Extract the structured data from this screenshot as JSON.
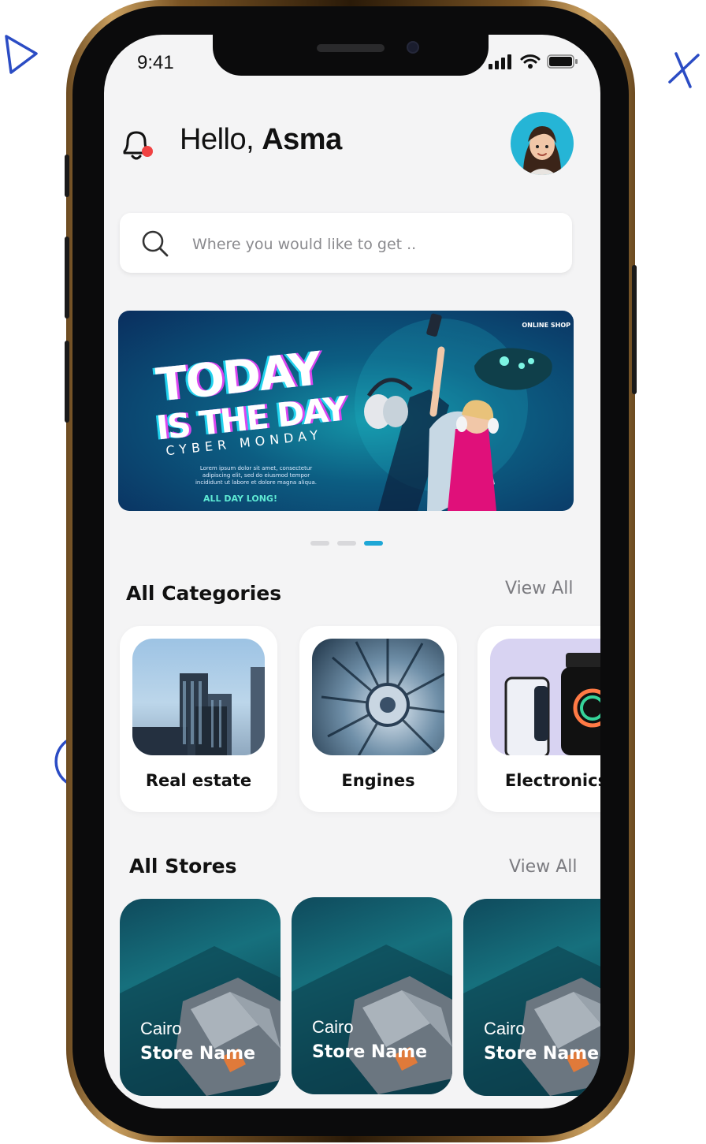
{
  "status_bar": {
    "time": "9:41"
  },
  "header": {
    "greeting_prefix": "Hello, ",
    "user_name": "Asma"
  },
  "search": {
    "placeholder": "Where you would like to get .."
  },
  "banner": {
    "line1": "TODAY",
    "line2": "IS THE DAY",
    "line3": "CYBER MONDAY",
    "body": "Lorem ipsum dolor sit amet, consectetur adipiscing elit, sed do eiusmod tempor incididunt ut labore et dolore magna aliqua.",
    "cta": "ALL DAY LONG!",
    "brand": "ONLINE SHOP"
  },
  "carousel": {
    "count": 3,
    "active_index": 2
  },
  "categories": {
    "title": "All Categories",
    "view_all": "View All",
    "items": [
      {
        "label": "Real estate"
      },
      {
        "label": "Engines"
      },
      {
        "label": "Electronics"
      }
    ]
  },
  "stores": {
    "title": "All Stores",
    "view_all": "View All",
    "items": [
      {
        "city": "Cairo",
        "name": "Store Name"
      },
      {
        "city": "Cairo",
        "name": "Store Name"
      },
      {
        "city": "Cairo",
        "name": "Store Name"
      }
    ]
  },
  "colors": {
    "accent": "#1ea7d6",
    "notification_dot": "#f04242",
    "avatar_bg": "#25b5d6",
    "screen_bg": "#f4f4f5"
  }
}
